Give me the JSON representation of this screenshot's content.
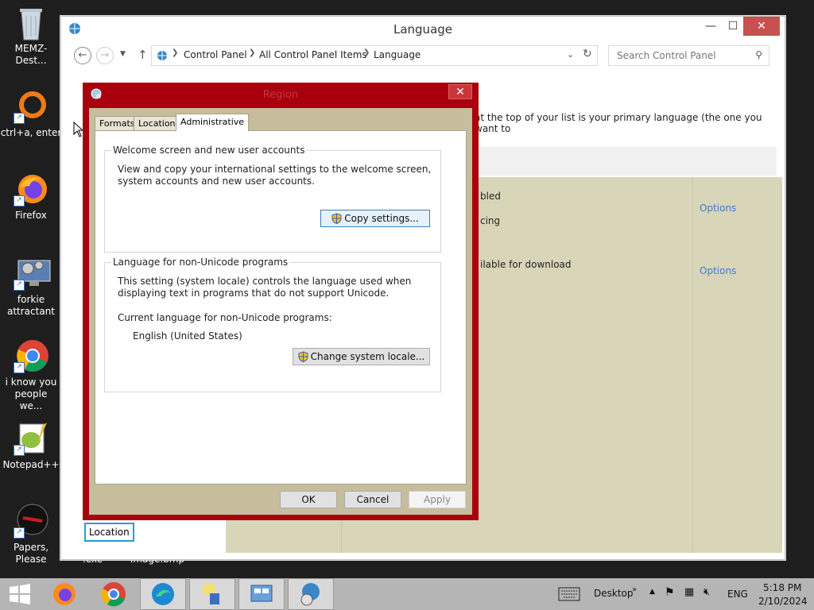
{
  "desktop": {
    "icons": [
      {
        "label": "MEMZ-Dest..."
      },
      {
        "label": "ctrl+a, enter"
      },
      {
        "label": "Firefox"
      },
      {
        "label": "forkie attractant"
      },
      {
        "label": "i know you people we..."
      },
      {
        "label": "Notepad++"
      },
      {
        "label": "Papers, Please"
      }
    ],
    "bottom_labels": [
      ".exe",
      "image.bmp"
    ]
  },
  "language_window": {
    "title": "Language",
    "breadcrumbs": [
      "Control Panel",
      "All Control Panel Items",
      "Language"
    ],
    "search_placeholder": "Search Control Panel",
    "bg_text_intro": "at the top of your list is your primary language (the one you want to",
    "bg_text_1": "bled",
    "bg_text_2": "cing",
    "bg_text_3": "ilable for download",
    "options_label": "Options"
  },
  "region_dialog": {
    "title": "Region",
    "tabs": [
      "Formats",
      "Location",
      "Administrative"
    ],
    "group1_title": "Welcome screen and new user accounts",
    "group1_text": "View and copy your international settings to the welcome screen, system accounts and new user accounts.",
    "copy_button": "Copy settings...",
    "group2_title": "Language for non-Unicode programs",
    "group2_text": "This setting (system locale) controls the language used when displaying text in programs that do not support Unicode.",
    "current_lang_label": "Current language for non-Unicode programs:",
    "current_lang_value": "English (United States)",
    "change_locale_button": "Change system locale...",
    "ok": "OK",
    "cancel": "Cancel",
    "apply": "Apply"
  },
  "location_label": "Location",
  "taskbar": {
    "desktop_label": "Desktop",
    "lang": "ENG",
    "time": "5:18 PM",
    "date": "2/10/2024"
  }
}
